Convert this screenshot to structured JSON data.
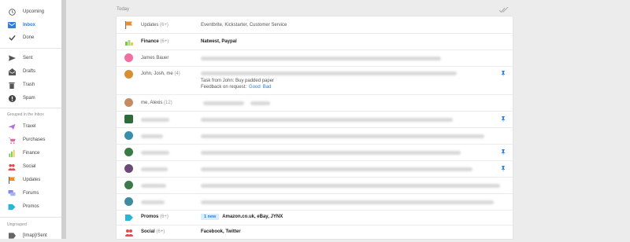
{
  "sidebar": {
    "main_items": [
      {
        "label": "Upcoming",
        "icon": "clock-icon"
      },
      {
        "label": "Inbox",
        "icon": "inbox-icon",
        "active": true
      },
      {
        "label": "Done",
        "icon": "check-icon"
      }
    ],
    "mail_items": [
      {
        "label": "Sent",
        "icon": "send-icon"
      },
      {
        "label": "Drafts",
        "icon": "drafts-icon"
      },
      {
        "label": "Trash",
        "icon": "trash-icon"
      },
      {
        "label": "Spam",
        "icon": "spam-icon"
      }
    ],
    "grouped_heading": "Grouped in the Inbox",
    "grouped_items": [
      {
        "label": "Travel",
        "icon": "plane-icon",
        "color": "#b36fd6"
      },
      {
        "label": "Purchases",
        "icon": "cart-icon",
        "color": "#e06aa0"
      },
      {
        "label": "Finance",
        "icon": "chart-icon",
        "color": "#7ac943"
      },
      {
        "label": "Social",
        "icon": "people-icon",
        "color": "#e04e4e"
      },
      {
        "label": "Updates",
        "icon": "flag-icon",
        "color": "#f08a24"
      },
      {
        "label": "Forums",
        "icon": "forum-icon",
        "color": "#7e8ce0"
      },
      {
        "label": "Promos",
        "icon": "tag-icon",
        "color": "#29b6d6"
      }
    ],
    "ungrouped_heading": "Ungrouped",
    "ungrouped_items": [
      {
        "label": "[Imap]/Sent",
        "icon": "label-icon"
      }
    ]
  },
  "main": {
    "day_label": "Today",
    "rows": [
      {
        "sender": "Updates",
        "count": "(6+)",
        "snippet": "Eventbrite, Kickstarter, Customer Service"
      },
      {
        "sender": "Finance",
        "count": "(6+)",
        "snippet": "Natwest, Paypal"
      },
      {
        "sender": "James Bauer"
      },
      {
        "sender": "John, Josh, me",
        "count": "(4)",
        "task": "Task from John: Buy padded paper",
        "feedback": "Feedback on request:",
        "good": "Good",
        "bad": "Bad"
      },
      {
        "sender": "me, Alexis",
        "count": "(12)"
      },
      {
        "sender": "Promos",
        "count": "(6+)",
        "badge": "1 new",
        "snippet": "Amazon.co.uk, eBay, JYNX"
      },
      {
        "sender": "Social",
        "count": "(6+)",
        "snippet": "Facebook, Twitter"
      }
    ]
  },
  "colors": {
    "accent": "#2a7de1",
    "updates": "#f08a24",
    "finance": "#7ac943",
    "promos": "#29b6d6",
    "social": "#e04e4e"
  }
}
